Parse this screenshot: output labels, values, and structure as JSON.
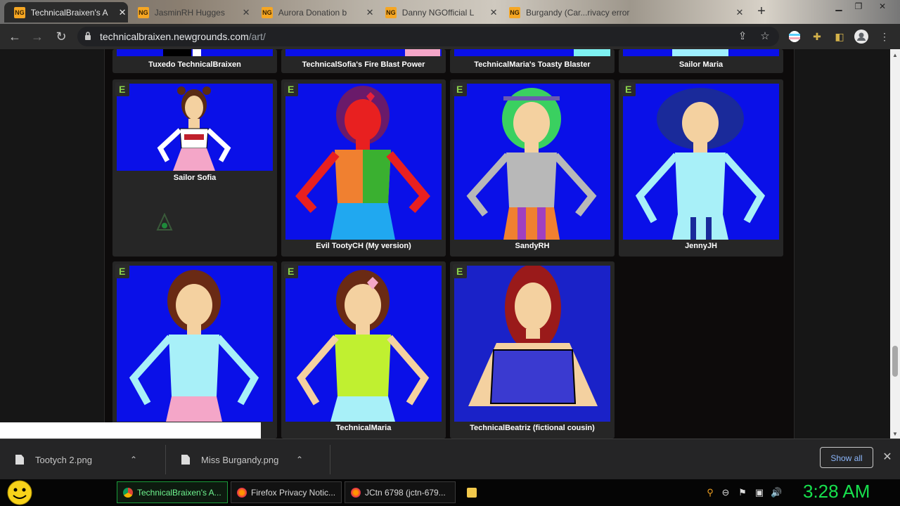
{
  "tabs": [
    {
      "label": "TechnicalBraixen's A",
      "active": true
    },
    {
      "label": "JasminRH Hugges",
      "active": false
    },
    {
      "label": "Aurora Donation b",
      "active": false
    },
    {
      "label": "Danny NGOfficial L",
      "active": false
    },
    {
      "label": "Burgandy (Car...rivacy error",
      "active": false
    }
  ],
  "toolbar": {
    "url_host": "technicalbraixen.newgrounds.com",
    "url_path": "/art/"
  },
  "gallery": {
    "top_row": [
      {
        "title": "Tuxedo TechnicalBraixen"
      },
      {
        "title": "TechnicalSofia's Fire Blast Power"
      },
      {
        "title": "TechnicalMaria's Toasty Blaster"
      },
      {
        "title": "Sailor Maria"
      }
    ],
    "cards": [
      {
        "title": "Sailor Sofia",
        "rating": "E"
      },
      {
        "title": "Evil TootyCH (My version)",
        "rating": "E"
      },
      {
        "title": "SandyRH",
        "rating": "E"
      },
      {
        "title": "JennyJH",
        "rating": "E"
      },
      {
        "title": "",
        "rating": "E"
      },
      {
        "title": "TechnicalMaria",
        "rating": "E"
      },
      {
        "title": "TechnicalBeatriz (fictional cousin)",
        "rating": "E"
      }
    ]
  },
  "downloads": {
    "items": [
      {
        "name": "Tootych 2.png"
      },
      {
        "name": "Miss Burgandy.png"
      }
    ],
    "show_all": "Show all"
  },
  "taskbar": {
    "items": [
      {
        "label": "TechnicalBraixen's A...",
        "active": true
      },
      {
        "label": "Firefox Privacy Notic...",
        "active": false
      },
      {
        "label": "JCtn 6798 (jctn-679...",
        "active": false
      }
    ],
    "clock": "3:28 AM"
  },
  "colors": {
    "thumb_bg": "#0a10e8",
    "rating_green": "#8bd34b",
    "clock_green": "#17e04d",
    "show_all_blue": "#8ab4f8"
  }
}
